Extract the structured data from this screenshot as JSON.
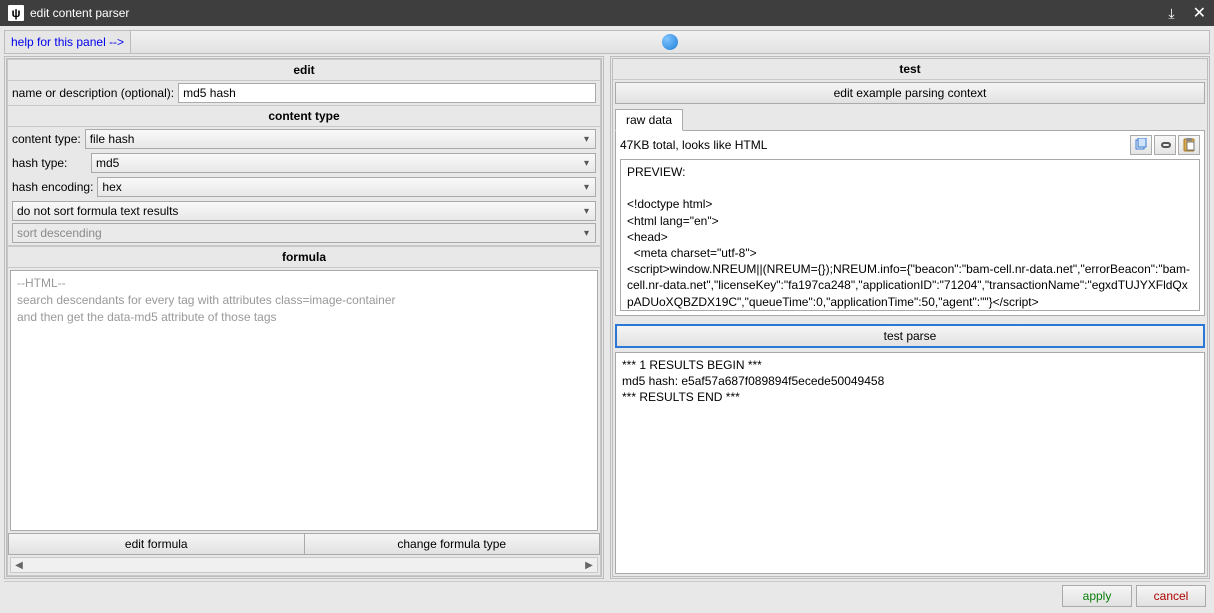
{
  "window": {
    "title": "edit content parser"
  },
  "help": {
    "link_text": "help for this panel -->"
  },
  "edit": {
    "title": "edit",
    "name_label": "name or description (optional):",
    "name_value": "md5 hash",
    "content_type_title": "content type",
    "content_type_label": "content type:",
    "content_type_value": "file hash",
    "hash_type_label": "hash type:",
    "hash_type_value": "md5",
    "hash_enc_label": "hash encoding:",
    "hash_enc_value": "hex",
    "sort_value": "do not sort formula text results",
    "sort_order_value": "sort descending"
  },
  "formula": {
    "title": "formula",
    "text": "--HTML--\nsearch descendants for every tag with attributes class=image-container\nand then get the data-md5 attribute of those tags",
    "edit_btn": "edit formula",
    "change_btn": "change formula type"
  },
  "test": {
    "title": "test",
    "context_btn": "edit example parsing context",
    "tab_raw": "raw data",
    "size_info": "47KB total, looks like HTML",
    "preview_label": "PREVIEW:",
    "preview_body": "<!doctype html>\n<html lang=\"en\">\n<head>\n  <meta charset=\"utf-8\">\n<script>window.NREUM||(NREUM={});NREUM.info={\"beacon\":\"bam-cell.nr-data.net\",\"errorBeacon\":\"bam-cell.nr-data.net\",\"licenseKey\":\"fa197ca248\",\"applicationID\":\"71204\",\"transactionName\":\"egxdTUJYXFldQxpADUoXQBZDX19C\",\"queueTime\":0,\"applicationTime\":50,\"agent\":\"\"}</script>\n<script>(window.NREUM||(NREUM={})).loader_config={licenseKey:\"fa197ca248\",applicationID:\"71204\"};window.NREUM||(NREUM={}),__nr_require=function(e,t,n){function r(n){if(!t[n]){var i=t[n]={exports:{}};e[n]",
    "test_parse_btn": "test parse",
    "results": "*** 1 RESULTS BEGIN ***\nmd5 hash: e5af57a687f089894f5ecede50049458\n*** RESULTS END ***"
  },
  "footer": {
    "apply": "apply",
    "cancel": "cancel"
  }
}
